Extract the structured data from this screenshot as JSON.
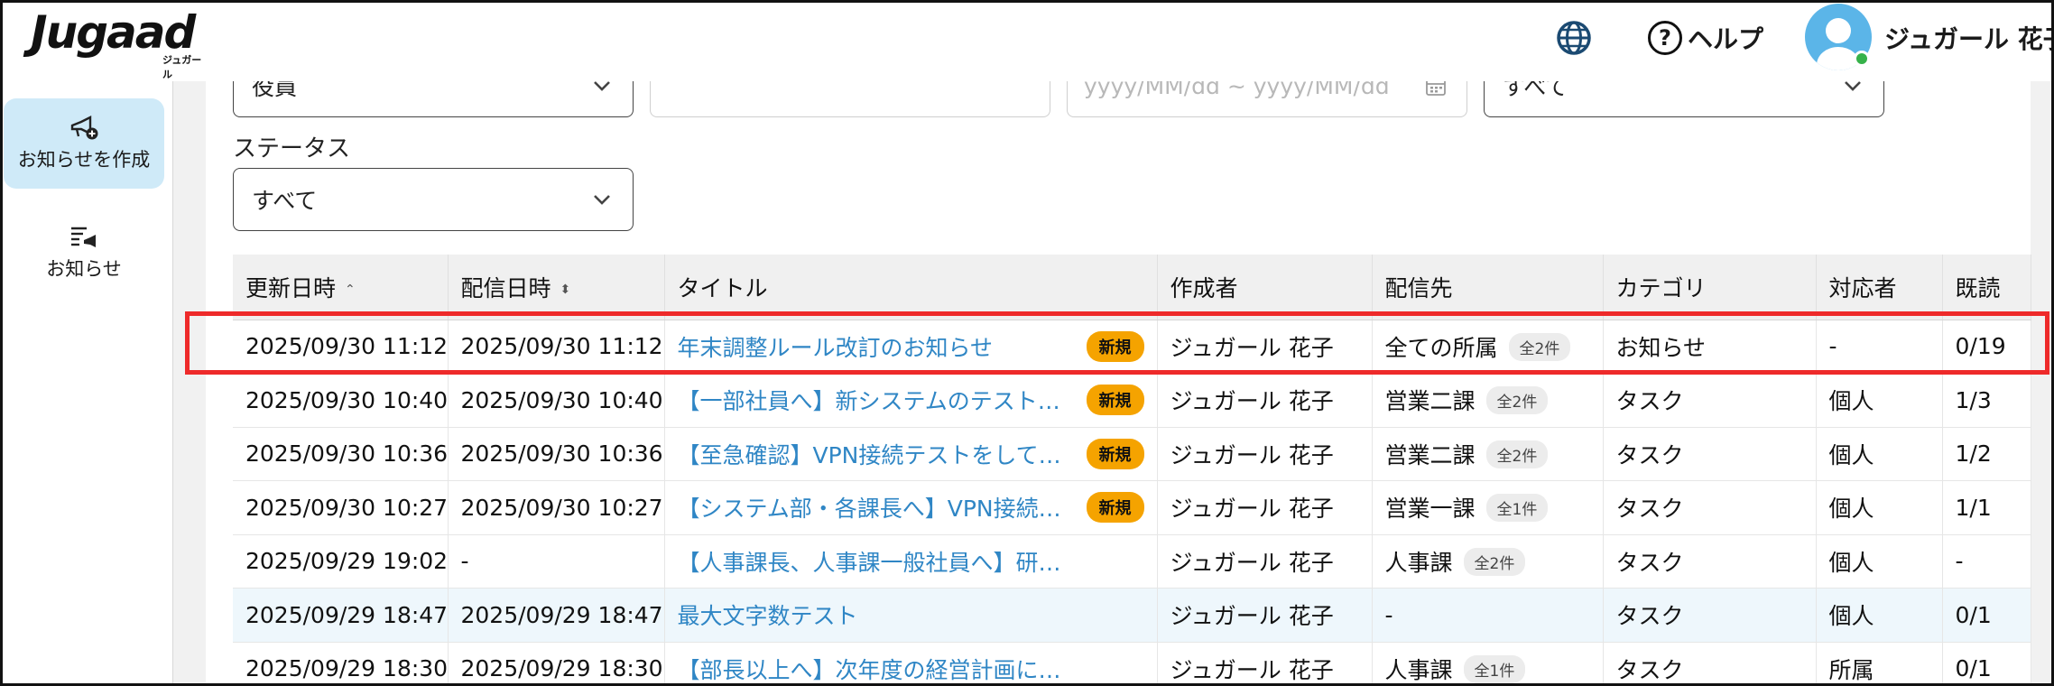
{
  "header": {
    "logo_text": "Jugaad",
    "logo_sub": "ジュガール",
    "help_label": "ヘルプ",
    "help_glyph": "?",
    "user_name": "ジュガール 花子"
  },
  "sidebar": {
    "items": [
      {
        "label": "お知らせを作成",
        "icon": "megaphone-plus-icon",
        "active": true
      },
      {
        "label": "お知らせ",
        "icon": "list-megaphone-icon",
        "active": false
      }
    ]
  },
  "filters": {
    "role_select": "役員",
    "text_field": "",
    "date_range_placeholder": "yyyy/MM/dd ~ yyyy/MM/dd",
    "category_select": "すべて",
    "status_label": "ステータス",
    "status_select": "すべて"
  },
  "table": {
    "columns": [
      "更新日時",
      "配信日時",
      "タイトル",
      "作成者",
      "配信先",
      "カテゴリ",
      "対応者",
      "既読"
    ],
    "sort_glyphs": [
      "⌃",
      "⬍"
    ],
    "rows": [
      {
        "updated": "2025/09/30 11:12",
        "delivered": "2025/09/30 11:12",
        "title": "年末調整ルール改訂のお知らせ",
        "is_new": true,
        "new_label": "新規",
        "author": "ジュガール 花子",
        "dest": "全ての所属",
        "dest_count": "全2件",
        "category": "お知らせ",
        "assignee": "-",
        "read": "0/19"
      },
      {
        "updated": "2025/09/30 10:40",
        "delivered": "2025/09/30 10:40",
        "title": "【一部社員へ】新システムのテスト…",
        "is_new": true,
        "new_label": "新規",
        "author": "ジュガール 花子",
        "dest": "営業二課",
        "dest_count": "全2件",
        "category": "タスク",
        "assignee": "個人",
        "read": "1/3"
      },
      {
        "updated": "2025/09/30 10:36",
        "delivered": "2025/09/30 10:36",
        "title": "【至急確認】VPN接続テストをして…",
        "is_new": true,
        "new_label": "新規",
        "author": "ジュガール 花子",
        "dest": "営業二課",
        "dest_count": "全2件",
        "category": "タスク",
        "assignee": "個人",
        "read": "1/2"
      },
      {
        "updated": "2025/09/30 10:27",
        "delivered": "2025/09/30 10:27",
        "title": "【システム部・各課長へ】VPN接続…",
        "is_new": true,
        "new_label": "新規",
        "author": "ジュガール 花子",
        "dest": "営業一課",
        "dest_count": "全1件",
        "category": "タスク",
        "assignee": "個人",
        "read": "1/1"
      },
      {
        "updated": "2025/09/29 19:02",
        "delivered": "-",
        "title": "【人事課長、人事課一般社員へ】研…",
        "is_new": false,
        "new_label": "",
        "author": "ジュガール 花子",
        "dest": "人事課",
        "dest_count": "全2件",
        "category": "タスク",
        "assignee": "個人",
        "read": "-"
      },
      {
        "updated": "2025/09/29 18:47",
        "delivered": "2025/09/29 18:47",
        "title": "最大文字数テスト",
        "is_new": false,
        "new_label": "",
        "author": "ジュガール 花子",
        "dest": "-",
        "dest_count": "",
        "category": "タスク",
        "assignee": "個人",
        "read": "0/1"
      },
      {
        "updated": "2025/09/29 18:30",
        "delivered": "2025/09/29 18:30",
        "title": "【部長以上へ】次年度の経営計画に…",
        "is_new": false,
        "new_label": "",
        "author": "ジュガール 花子",
        "dest": "人事課",
        "dest_count": "全1件",
        "category": "タスク",
        "assignee": "所属",
        "read": "0/1"
      }
    ]
  },
  "colors": {
    "link": "#2f86c5",
    "new_badge": "#f5a300",
    "highlight_box": "#ee2a2a",
    "active_nav": "#cfeaf8",
    "online": "#36b24a"
  }
}
